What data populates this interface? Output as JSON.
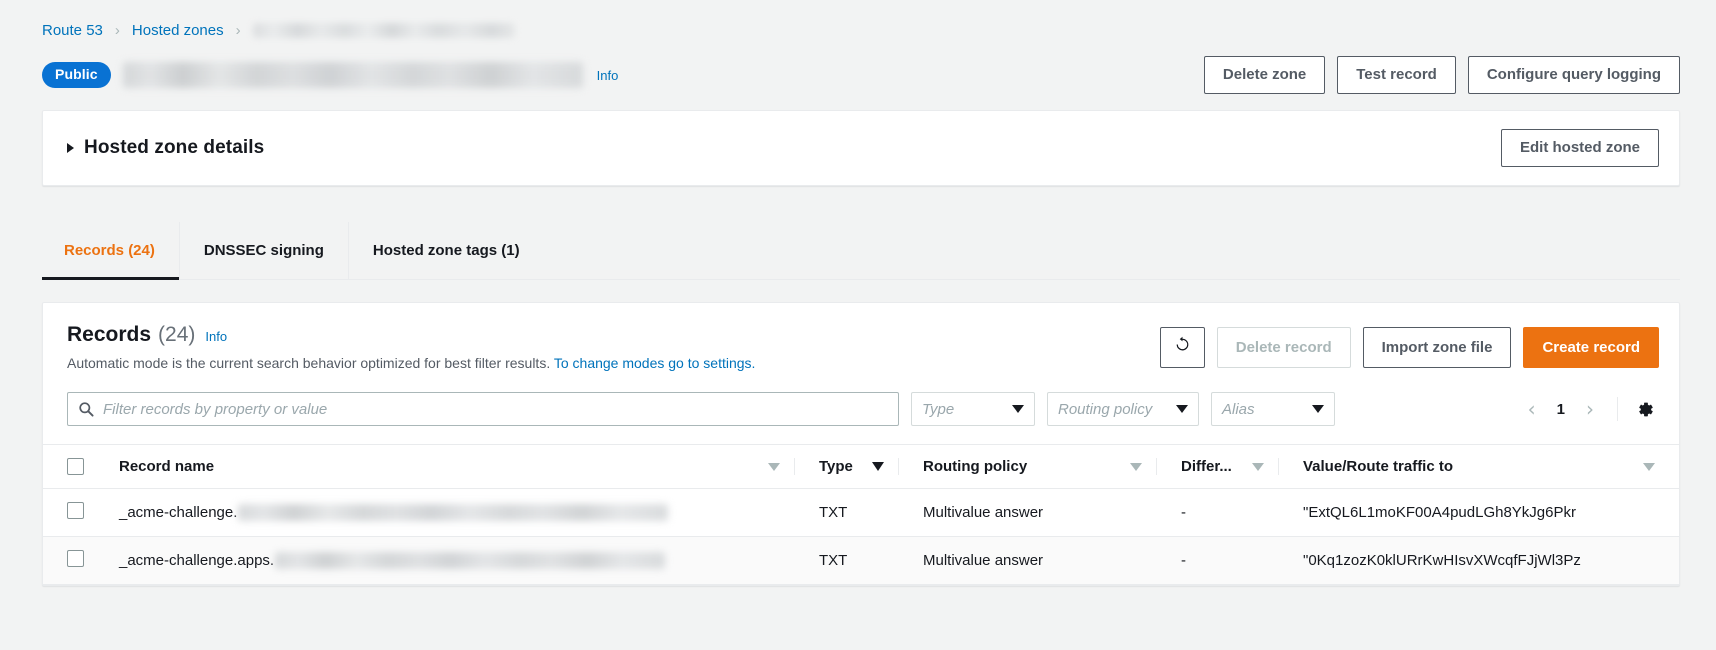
{
  "breadcrumb": {
    "items": [
      {
        "label": "Route 53",
        "link": true
      },
      {
        "label": "Hosted zones",
        "link": true
      },
      {
        "label": "",
        "link": false,
        "redacted": true
      }
    ],
    "separator": "›"
  },
  "header": {
    "badge": "Public",
    "zone_name_redacted": true,
    "info_label": "Info",
    "actions": [
      {
        "label": "Delete zone",
        "variant": "normal"
      },
      {
        "label": "Test record",
        "variant": "normal"
      },
      {
        "label": "Configure query logging",
        "variant": "normal"
      }
    ]
  },
  "details": {
    "title": "Hosted zone details",
    "expanded": false,
    "edit_label": "Edit hosted zone"
  },
  "tabs": [
    {
      "label": "Records (24)",
      "active": true
    },
    {
      "label": "DNSSEC signing",
      "active": false
    },
    {
      "label": "Hosted zone tags (1)",
      "active": false
    }
  ],
  "records_panel": {
    "title": "Records",
    "count": "(24)",
    "info_label": "Info",
    "description_text": "Automatic mode is the current search behavior optimized for best filter results.",
    "description_link": "To change modes go to settings.",
    "actions": [
      {
        "label": "",
        "icon": "refresh-icon",
        "variant": "icon",
        "disabled": false
      },
      {
        "label": "Delete record",
        "variant": "normal",
        "disabled": true
      },
      {
        "label": "Import zone file",
        "variant": "normal",
        "disabled": false
      },
      {
        "label": "Create record",
        "variant": "primary",
        "disabled": false
      }
    ],
    "search": {
      "placeholder": "Filter records by property or value",
      "value": ""
    },
    "filters": [
      {
        "name": "type",
        "placeholder": "Type",
        "value": ""
      },
      {
        "name": "routing-policy",
        "placeholder": "Routing policy",
        "value": ""
      },
      {
        "name": "alias",
        "placeholder": "Alias",
        "value": ""
      }
    ],
    "pagination": {
      "prev": "‹",
      "page": "1",
      "next": "›"
    },
    "table": {
      "columns": [
        {
          "key": "name",
          "label": "Record name",
          "sort": "outline"
        },
        {
          "key": "type",
          "label": "Type",
          "sort": "filled"
        },
        {
          "key": "routing",
          "label": "Routing policy",
          "sort": "outline"
        },
        {
          "key": "diff",
          "label": "Differ...",
          "sort": "outline"
        },
        {
          "key": "value",
          "label": "Value/Route traffic to",
          "sort": "outline"
        }
      ],
      "rows": [
        {
          "name_prefix": "_acme-challenge.",
          "name_redacted": true,
          "type": "TXT",
          "routing": "Multivalue answer",
          "diff": "-",
          "value": "\"ExtQL6L1moKF00A4pudLGh8YkJg6Pkr"
        },
        {
          "name_prefix": "_acme-challenge.apps.",
          "name_redacted": true,
          "type": "TXT",
          "routing": "Multivalue answer",
          "diff": "-",
          "value": "\"0Kq1zozK0klURrKwHIsvXWcqfFJjWl3Pz"
        }
      ]
    }
  },
  "colors": {
    "accent_orange": "#ec7211",
    "link_blue": "#0073bb",
    "badge_blue": "#0972d3",
    "text_dark": "#16191f",
    "text_muted": "#545b64",
    "border": "#e9ebed",
    "page_bg": "#f2f3f3"
  }
}
